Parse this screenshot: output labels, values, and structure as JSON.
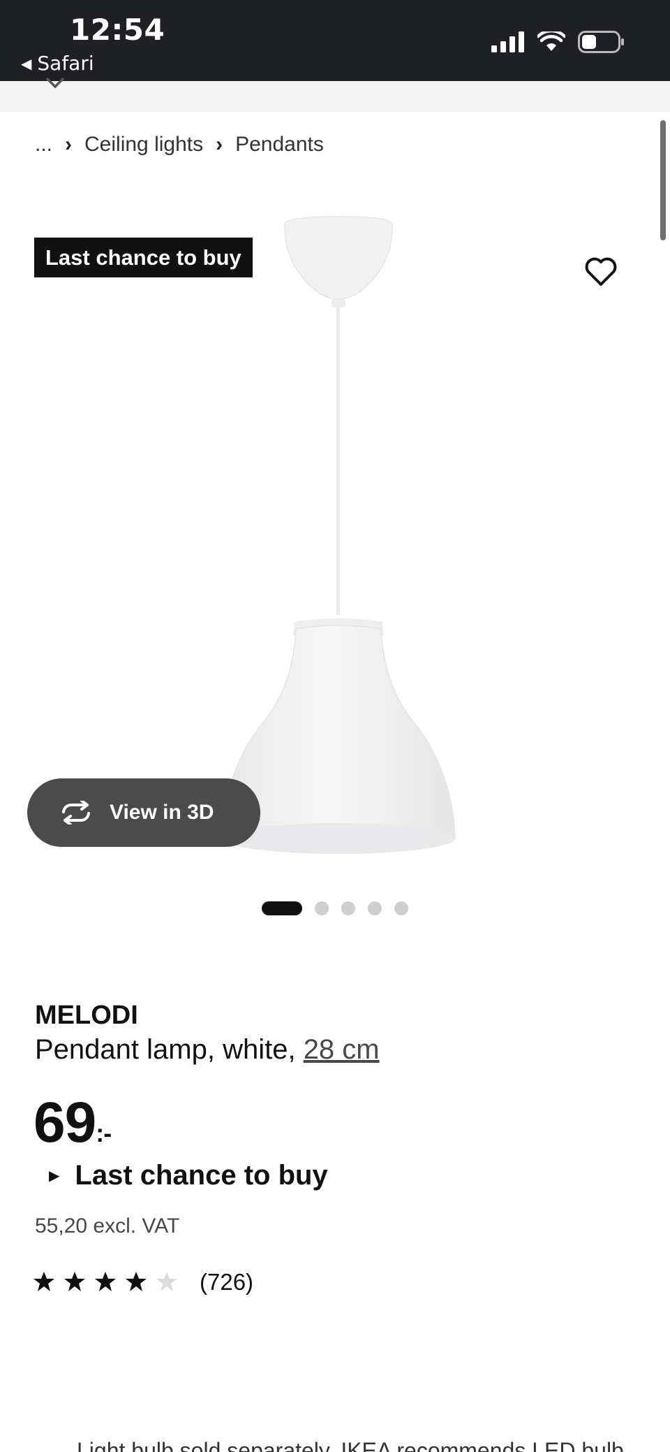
{
  "status_bar": {
    "time": "12:54",
    "back_label": "Safari",
    "icons": [
      "signal-icon",
      "wifi-icon",
      "battery-icon"
    ]
  },
  "breadcrumb": {
    "ellipsis": "...",
    "items": [
      "Ceiling lights",
      "Pendants"
    ]
  },
  "product_image": {
    "badge": "Last chance to buy",
    "view_3d_label": "View in 3D",
    "carousel_total": 5,
    "carousel_active": 1
  },
  "product": {
    "name": "MELODI",
    "description": "Pendant lamp, white,",
    "size": "28 cm",
    "price_main": "69",
    "price_suffix": ":-",
    "availability": "Last chance to buy",
    "price_excl_vat": "55,20 excl. VAT",
    "rating_value": 4.5,
    "rating_max": 5,
    "rating_count": "(726)"
  },
  "bottom_note": "Light bulb sold separately. IKEA recommends LED bulb",
  "colors": {
    "status_bar_bg": "#1f2024",
    "badge_bg": "#111111",
    "view3d_bg": "#4b4b4b",
    "text": "#111111"
  }
}
